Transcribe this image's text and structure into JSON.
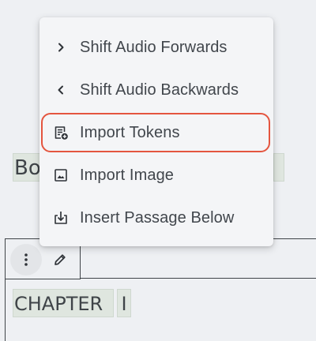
{
  "menu": {
    "items": [
      {
        "label": "Shift Audio Forwards",
        "icon": "chevron-right-icon"
      },
      {
        "label": "Shift Audio Backwards",
        "icon": "chevron-left-icon"
      },
      {
        "label": "Import Tokens",
        "icon": "import-tokens-icon",
        "highlighted": true
      },
      {
        "label": "Import Image",
        "icon": "image-icon"
      },
      {
        "label": "Insert Passage Below",
        "icon": "insert-below-icon"
      }
    ]
  },
  "editor": {
    "partial_token_left": "Bo",
    "chapter_word": "CHAPTER",
    "chapter_numeral": "I"
  },
  "colors": {
    "highlight_outline": "#e4553f",
    "token_background": "#dfe6df",
    "menu_background": "#f4f5f7"
  }
}
